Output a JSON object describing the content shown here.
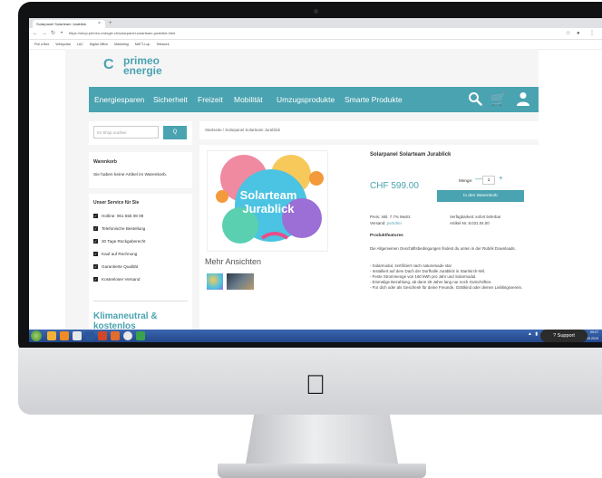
{
  "browser": {
    "tab_title": "Solarpanel Solarteam Jurablick",
    "url": "https://shop.primeo-energie.ch/solarpanel-solarteam-jurablick.html",
    "bookmarks": [
      "Pull a Bee",
      "Webportal",
      "LAC",
      "Digital Office",
      "Marketing",
      "MATT-Lop",
      "Telework"
    ]
  },
  "brand": {
    "line1": "primeo",
    "line2": "energie"
  },
  "nav": {
    "items": [
      "Energiesparen",
      "Sicherheit",
      "Freizeit",
      "Mobilität",
      "Umzugsprodukte",
      "Smarte Produkte"
    ]
  },
  "sidebar": {
    "search_placeholder": "Im Shop suchen",
    "search_button": "Q",
    "cart_title": "Warenkorb",
    "cart_empty": "Sie haben keine Artikel im Warenkorb.",
    "service_title": "Unser Service für Sie",
    "service_items": [
      "Hotline: 061 555 08 09",
      "Telefonische Bestellung",
      "30 Tage Rückgaberecht",
      "Kauf auf Rechnung",
      "Garantierte Qualität",
      "Kostenloser Versand"
    ],
    "klima_title": "Klimaneutral & kostenlos"
  },
  "breadcrumb": "Startseite  /  Solarpanel Solarteam Jurablick",
  "product": {
    "name": "Solarpanel Solarteam Jurablick",
    "image_title": "Solarteam",
    "image_subtitle": "Jurablick",
    "price": "CHF 599.00",
    "qty_label": "Menge:",
    "qty_value": "1",
    "qty_minus": "—",
    "qty_plus": "+",
    "add_to_cart": "In den Warenkorb",
    "info_price": "Preis: Inkl. 7.7% MwSt.",
    "info_shipping_label": "Versand:",
    "info_shipping_value": "portofrei",
    "info_availability": "Verfügbarkeit: sofort lieferbar",
    "info_article": "Artikel-Nr. 8.031.04.00",
    "features_title": "Produktfeatures",
    "features_intro": "Die Allgemeinen Geschäftsbedingungen findest du unten in der Rubrik Downloads.",
    "features": [
      "- Solarmodul, zertifiziert nach naturemade star",
      "- Installiert auf dem Dach der Dorfhalle Jurablick in Starrkirch-Wil.",
      "- Feste Strommenge von 160 kWh pro Jahr und Solarmodul.",
      "- Einmalige Bezahlung, ab dann 25 Jahre lang nur noch Gutschriften.",
      "- Für dich oder als Geschenk für deine Freunde, Göttikind oder deinen Lieblingsverein."
    ],
    "more_views": "Mehr Ansichten"
  },
  "support_label": "Support",
  "taskbar": {
    "clock_time": "09:27",
    "clock_date": "26.09.2019"
  },
  "colors": {
    "accent": "#4aa3b0",
    "taskbar": "#2f58a0"
  }
}
